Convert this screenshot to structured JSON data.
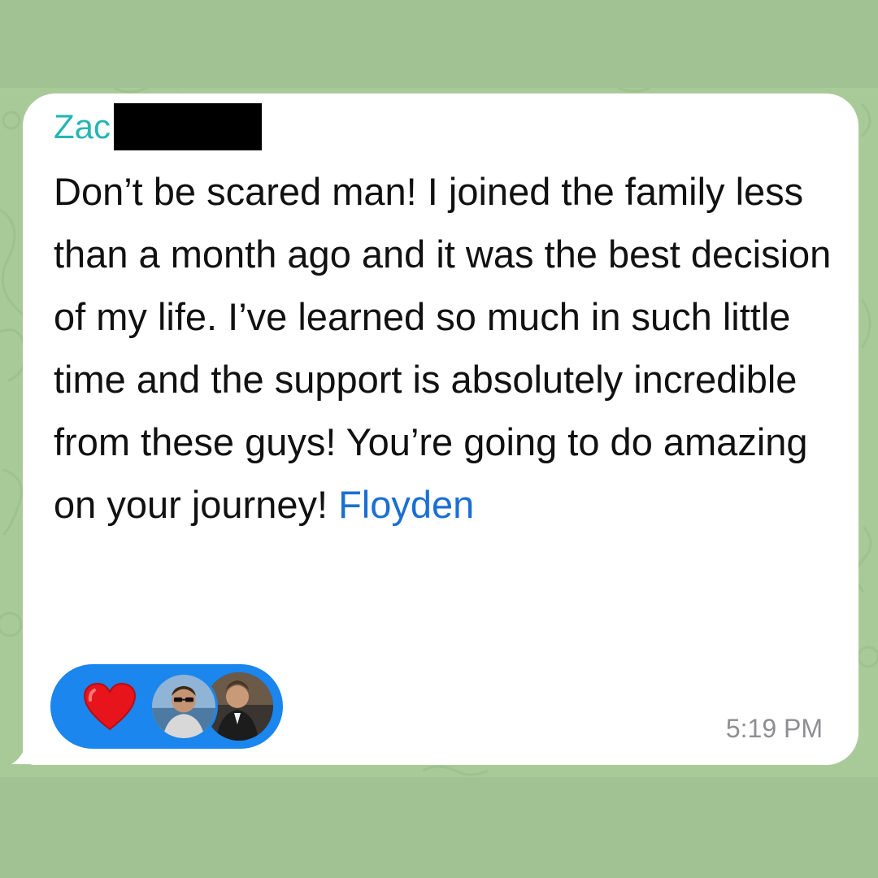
{
  "message": {
    "sender_name": "Zac",
    "text": "Don’t be scared man! I joined the family less than a month ago and it was the best decision of my life. I’ve learned so much in such little time and the support is absolutely incredible from these guys! You’re going to do amazing on your journey! ",
    "mention": "Floyden",
    "time": "5:19 PM"
  },
  "reaction": {
    "emoji_icon": "red-heart-icon",
    "reactors": [
      "avatar-photo-man-sunglasses",
      "avatar-photo-man-suit"
    ]
  },
  "colors": {
    "page_background": "#a1c394",
    "bubble": "#ffffff",
    "sender_name": "#28b5b5",
    "mention": "#1b6fd4",
    "reaction_pill": "#1a86ee",
    "timestamp": "#8e8e93"
  }
}
